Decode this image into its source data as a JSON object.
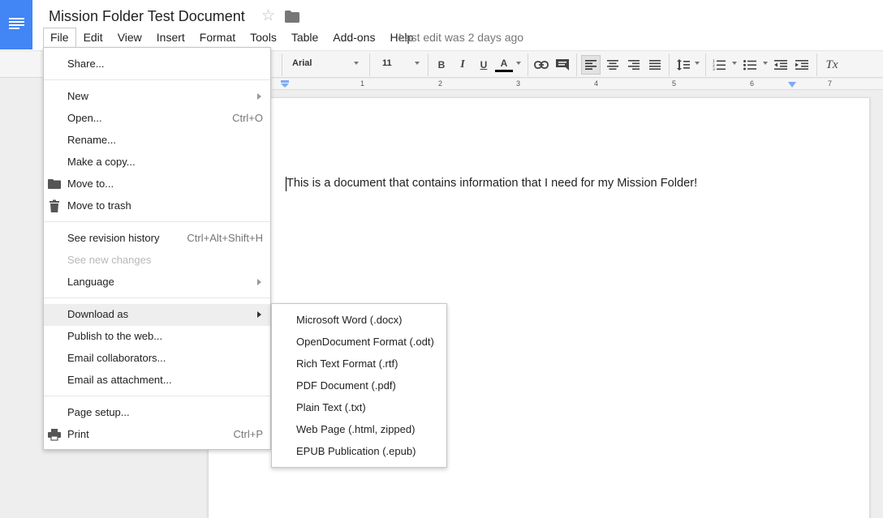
{
  "document": {
    "title": "Mission Folder Test Document",
    "last_edit": "Last edit was 2 days ago",
    "body_text": "This is a document that contains information that I need for my Mission Folder!"
  },
  "menubar": [
    "File",
    "Edit",
    "View",
    "Insert",
    "Format",
    "Tools",
    "Table",
    "Add-ons",
    "Help"
  ],
  "toolbar": {
    "font": "Arial",
    "font_size": "11",
    "bold": "B",
    "italic": "I",
    "underline": "U",
    "text_color": "A",
    "text_color_bar": "#000000",
    "clear_formatting": "Tx"
  },
  "ruler": [
    "1",
    "2",
    "3",
    "4",
    "5",
    "6",
    "7"
  ],
  "file_menu": {
    "items": [
      {
        "label": "Share...",
        "shortcut": "",
        "submenu": false,
        "disabled": false,
        "icon": ""
      },
      {
        "label": "New",
        "shortcut": "",
        "submenu": true,
        "disabled": false,
        "icon": ""
      },
      {
        "label": "Open...",
        "shortcut": "Ctrl+O",
        "submenu": false,
        "disabled": false,
        "icon": ""
      },
      {
        "label": "Rename...",
        "shortcut": "",
        "submenu": false,
        "disabled": false,
        "icon": ""
      },
      {
        "label": "Make a copy...",
        "shortcut": "",
        "submenu": false,
        "disabled": false,
        "icon": ""
      },
      {
        "label": "Move to...",
        "shortcut": "",
        "submenu": false,
        "disabled": false,
        "icon": "folder-icon"
      },
      {
        "label": "Move to trash",
        "shortcut": "",
        "submenu": false,
        "disabled": false,
        "icon": "trash-icon"
      },
      {
        "label": "See revision history",
        "shortcut": "Ctrl+Alt+Shift+H",
        "submenu": false,
        "disabled": false,
        "icon": ""
      },
      {
        "label": "See new changes",
        "shortcut": "",
        "submenu": false,
        "disabled": true,
        "icon": ""
      },
      {
        "label": "Language",
        "shortcut": "",
        "submenu": true,
        "disabled": false,
        "icon": ""
      },
      {
        "label": "Download as",
        "shortcut": "",
        "submenu": true,
        "disabled": false,
        "icon": "",
        "highlighted": true
      },
      {
        "label": "Publish to the web...",
        "shortcut": "",
        "submenu": false,
        "disabled": false,
        "icon": ""
      },
      {
        "label": "Email collaborators...",
        "shortcut": "",
        "submenu": false,
        "disabled": false,
        "icon": ""
      },
      {
        "label": "Email as attachment...",
        "shortcut": "",
        "submenu": false,
        "disabled": false,
        "icon": ""
      },
      {
        "label": "Page setup...",
        "shortcut": "",
        "submenu": false,
        "disabled": false,
        "icon": ""
      },
      {
        "label": "Print",
        "shortcut": "Ctrl+P",
        "submenu": false,
        "disabled": false,
        "icon": "print-icon"
      }
    ]
  },
  "download_submenu": {
    "items": [
      "Microsoft Word (.docx)",
      "OpenDocument Format (.odt)",
      "Rich Text Format (.rtf)",
      "PDF Document (.pdf)",
      "Plain Text (.txt)",
      "Web Page (.html, zipped)",
      "EPUB Publication (.epub)"
    ]
  },
  "colors": {
    "brand": "#4285f4",
    "menu_hover": "#eeeeee",
    "disabled_text": "#b8b8b8"
  }
}
